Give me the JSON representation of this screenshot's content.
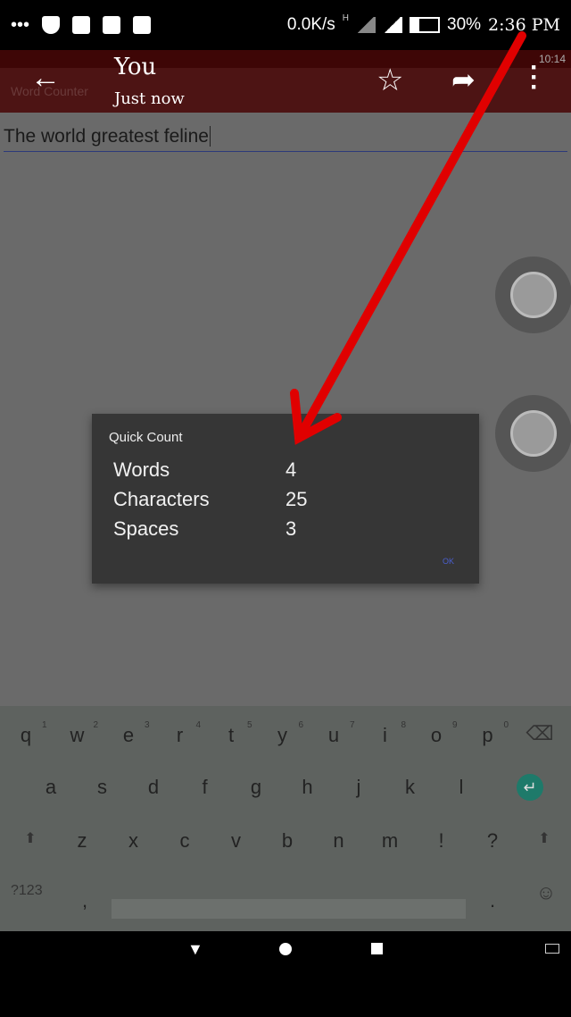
{
  "status_bar": {
    "net_speed": "0.0K/s",
    "signal_label": "H",
    "battery": "30%",
    "time": "2:36 PM",
    "icons": [
      "more-icon",
      "shield-icon",
      "image-icon",
      "gmail-icon",
      "message-icon"
    ]
  },
  "viewer": {
    "sender": "You",
    "subtitle": "Just now",
    "icons": [
      "back-arrow-icon",
      "star-icon",
      "share-icon",
      "more-vertical-icon"
    ]
  },
  "inner_app": {
    "status_time": "10:14",
    "title": "Word Counter"
  },
  "text_input": {
    "value": "The world greatest feline"
  },
  "dialog": {
    "title": "Quick Count",
    "rows": [
      {
        "label": "Words",
        "value": "4"
      },
      {
        "label": "Characters",
        "value": "25"
      },
      {
        "label": "Spaces",
        "value": "3"
      }
    ],
    "ok_label": "OK"
  },
  "keyboard": {
    "row1": [
      "q",
      "w",
      "e",
      "r",
      "t",
      "y",
      "u",
      "i",
      "o",
      "p"
    ],
    "numbers": [
      "1",
      "2",
      "3",
      "4",
      "5",
      "6",
      "7",
      "8",
      "9",
      "0"
    ],
    "row2": [
      "a",
      "s",
      "d",
      "f",
      "g",
      "h",
      "j",
      "k",
      "l"
    ],
    "row3": [
      "z",
      "x",
      "c",
      "v",
      "b",
      "n",
      "m",
      "!",
      "?"
    ],
    "symbols_label": "?123",
    "comma": ",",
    "period": ".",
    "enter_color": "#1e7a6a"
  },
  "annotation_color": "#e00000"
}
